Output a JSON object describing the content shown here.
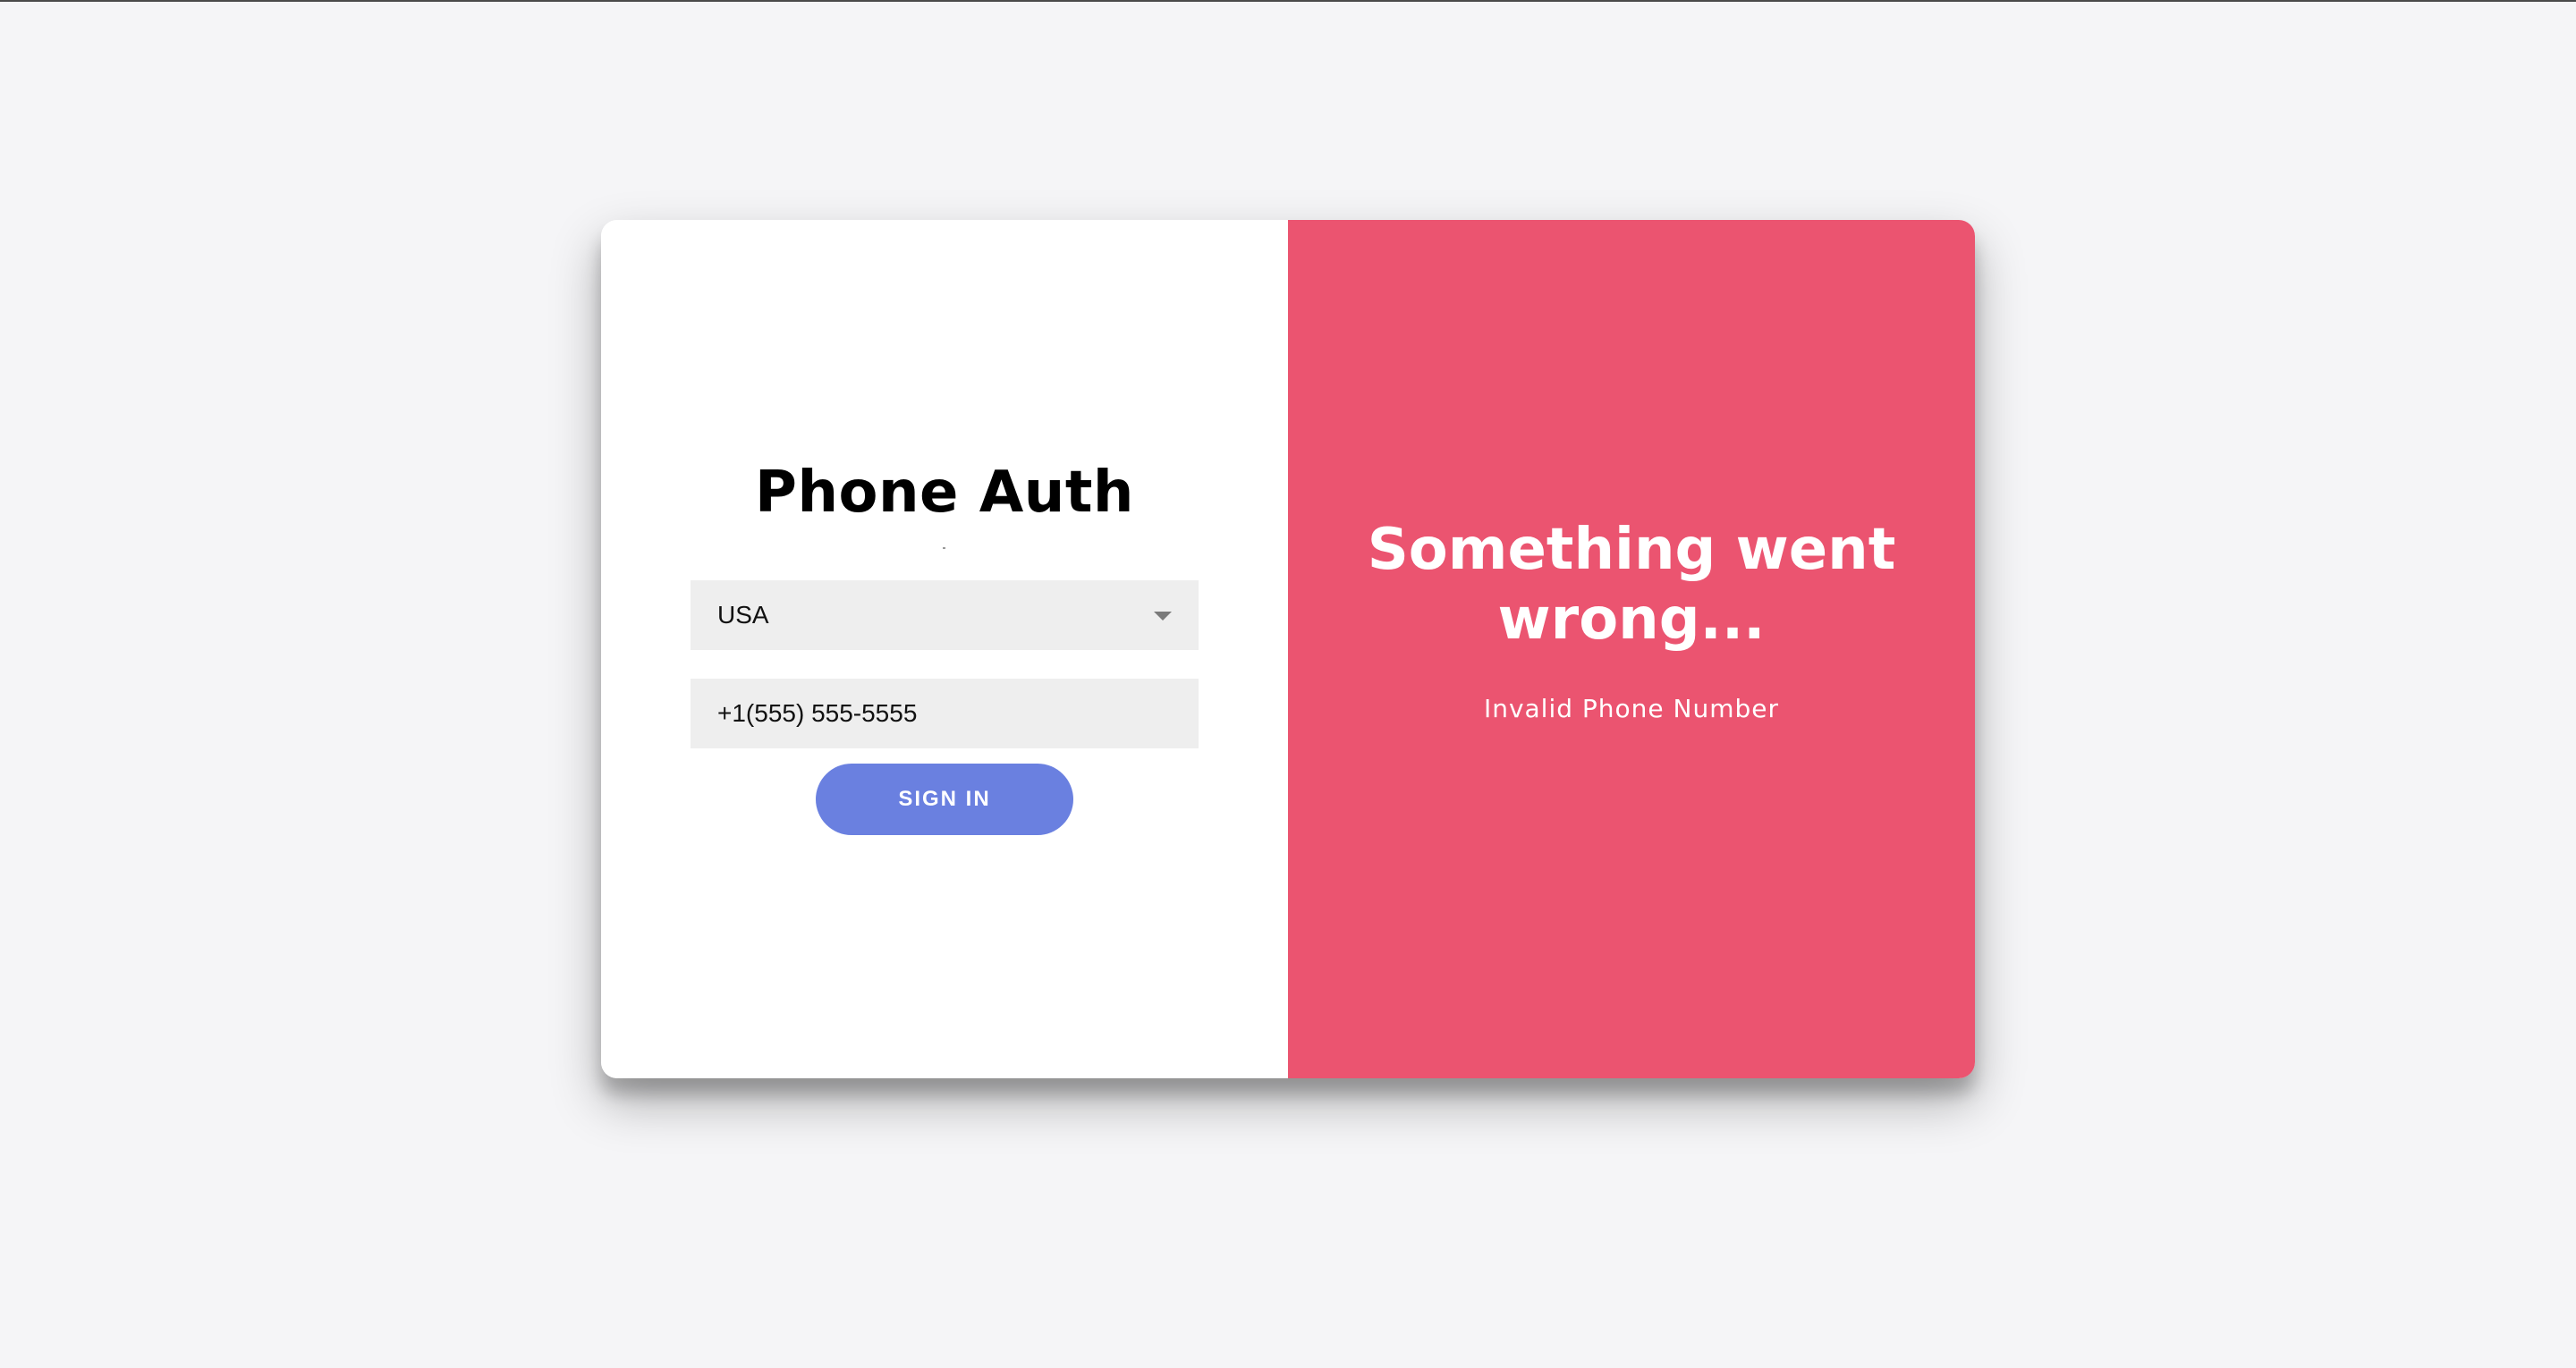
{
  "auth_form": {
    "title": "Phone Auth",
    "country_select": {
      "selected": "USA",
      "icon": "chevron-down-icon"
    },
    "phone_input": {
      "value": "+1(555) 555-5555"
    },
    "submit_label": "SIGN IN"
  },
  "error_panel": {
    "title_line1": "Something went",
    "title_line2": "wrong...",
    "message": "Invalid Phone Number"
  },
  "colors": {
    "page_background": "#f5f5f7",
    "error_panel": "#eb5470",
    "button": "#6a80e0",
    "input_background": "#eeeeee"
  }
}
